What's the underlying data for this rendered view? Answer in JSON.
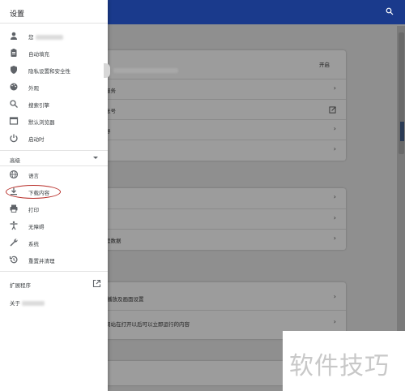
{
  "drawer": {
    "title": "设置",
    "items": [
      {
        "label": "您",
        "icon": "person-icon"
      },
      {
        "label": "自动填充",
        "icon": "clipboard-icon"
      },
      {
        "label": "隐私设置和安全性",
        "icon": "shield-icon"
      },
      {
        "label": "外观",
        "icon": "palette-icon"
      },
      {
        "label": "搜索引擎",
        "icon": "search-icon"
      },
      {
        "label": "默认浏览器",
        "icon": "browser-window-icon"
      },
      {
        "label": "启动时",
        "icon": "power-icon"
      }
    ],
    "advanced_label": "高级",
    "advanced_items": [
      {
        "label": "语言",
        "icon": "globe-icon"
      },
      {
        "label": "下载内容",
        "icon": "download-icon"
      },
      {
        "label": "打印",
        "icon": "printer-icon"
      },
      {
        "label": "无障碍",
        "icon": "accessibility-icon"
      },
      {
        "label": "系统",
        "icon": "wrench-icon"
      },
      {
        "label": "重置并清理",
        "icon": "restore-icon"
      }
    ],
    "extensions_label": "扩展程序",
    "about_label": "关于"
  },
  "background": {
    "card1": {
      "header_action": "开启",
      "rows": [
        "服务",
        "账号",
        "导",
        ""
      ]
    },
    "card2": {
      "rows": [
        "",
        "",
        "程数据"
      ]
    },
    "card3": {
      "rows": [
        "播放及画面设置",
        "网站在打开以后可以立即运行的内容"
      ]
    }
  },
  "watermark": {
    "text": "软件技巧"
  },
  "colors": {
    "topbar": "#1a3a8c",
    "highlight": "#b9312c"
  }
}
